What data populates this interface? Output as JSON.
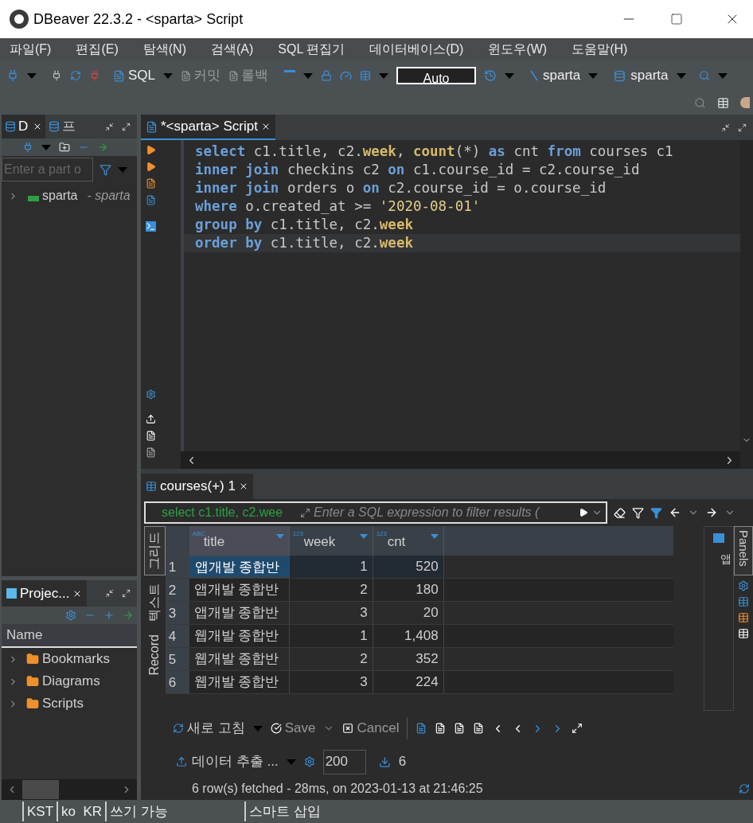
{
  "window": {
    "title": "DBeaver 22.3.2 - <sparta> Script"
  },
  "menu": [
    "파일(F)",
    "편집(E)",
    "탐색(N)",
    "검색(A)",
    "SQL 편집기",
    "데이터베이스(D)",
    "윈도우(W)",
    "도움말(H)"
  ],
  "toolbar": {
    "sql": "SQL",
    "commit": "커밋",
    "rollback": "롤백",
    "transaction_mode": "Auto",
    "datasource": "sparta",
    "schema": "sparta"
  },
  "navigator": {
    "tabs": [
      {
        "label": "D",
        "selected": true
      },
      {
        "label": "프",
        "selected": false
      }
    ],
    "filter": {
      "placeholder": "Enter a part o"
    },
    "tree": [
      {
        "label": "sparta",
        "detail": "- sparta",
        "expanded": false
      }
    ]
  },
  "projects": {
    "tab": "Projec...",
    "column": "Name",
    "items": [
      {
        "label": "Bookmarks",
        "expanded": false
      },
      {
        "label": "Diagrams",
        "expanded": false
      },
      {
        "label": "Scripts",
        "expanded": false
      }
    ]
  },
  "editor": {
    "tab": "*<sparta> Script",
    "lines": [
      {
        "current": false,
        "tokens": [
          {
            "kind": "keyword",
            "text": "select"
          },
          {
            "kind": "plain",
            "text": " c1.title, c2."
          },
          {
            "kind": "field",
            "text": "week"
          },
          {
            "kind": "plain",
            "text": ", "
          },
          {
            "kind": "field",
            "text": "count"
          },
          {
            "kind": "plain",
            "text": "(*) "
          },
          {
            "kind": "keyword",
            "text": "as"
          },
          {
            "kind": "plain",
            "text": " cnt "
          },
          {
            "kind": "keyword",
            "text": "from"
          },
          {
            "kind": "plain",
            "text": " courses c1"
          }
        ]
      },
      {
        "current": false,
        "tokens": [
          {
            "kind": "keyword",
            "text": "inner join"
          },
          {
            "kind": "plain",
            "text": " checkins c2 "
          },
          {
            "kind": "keyword",
            "text": "on"
          },
          {
            "kind": "plain",
            "text": " c1.course_id = c2.course_id"
          }
        ]
      },
      {
        "current": false,
        "tokens": [
          {
            "kind": "keyword",
            "text": "inner join"
          },
          {
            "kind": "plain",
            "text": " orders o "
          },
          {
            "kind": "keyword",
            "text": "on"
          },
          {
            "kind": "plain",
            "text": " c2.course_id = o.course_id"
          }
        ]
      },
      {
        "current": false,
        "tokens": [
          {
            "kind": "keyword",
            "text": "where"
          },
          {
            "kind": "plain",
            "text": " o.created_at >= "
          },
          {
            "kind": "string",
            "text": "'2020-08-01'"
          }
        ]
      },
      {
        "current": false,
        "tokens": [
          {
            "kind": "keyword",
            "text": "group by"
          },
          {
            "kind": "plain",
            "text": " c1.title, c2."
          },
          {
            "kind": "field",
            "text": "week"
          }
        ]
      },
      {
        "current": true,
        "tokens": [
          {
            "kind": "keyword",
            "text": "order by"
          },
          {
            "kind": "plain",
            "text": " c1.title, c2."
          },
          {
            "kind": "field",
            "text": "week"
          }
        ]
      }
    ]
  },
  "results": {
    "tab": "courses(+) 1",
    "query": "select c1.title, c2.wee",
    "filter": {
      "placeholder": "Enter a SQL expression to filter results ("
    },
    "side_tabs": [
      {
        "label": "그리드",
        "selected": true
      },
      {
        "label": "텍스트",
        "selected": false
      },
      {
        "label": "Record",
        "selected": false
      }
    ],
    "columns": [
      {
        "name": "title",
        "type": "ABC",
        "kind": "text"
      },
      {
        "name": "week",
        "type": "123",
        "kind": "number"
      },
      {
        "name": "cnt",
        "type": "123",
        "kind": "number"
      }
    ],
    "rows": [
      {
        "number": "1",
        "cells": [
          "앱개발 종합반",
          "1",
          "520"
        ],
        "selected": true
      },
      {
        "number": "2",
        "cells": [
          "앱개발 종합반",
          "2",
          "180"
        ],
        "selected": false
      },
      {
        "number": "3",
        "cells": [
          "앱개발 종합반",
          "3",
          "20"
        ],
        "selected": false
      },
      {
        "number": "4",
        "cells": [
          "웹개발 종합반",
          "1",
          "1,408"
        ],
        "selected": false
      },
      {
        "number": "5",
        "cells": [
          "웹개발 종합반",
          "2",
          "352"
        ],
        "selected": false
      },
      {
        "number": "6",
        "cells": [
          "웹개발 종합반",
          "3",
          "224"
        ],
        "selected": false
      }
    ],
    "side_panel": {
      "label": "앱",
      "tab": "Panels"
    },
    "refresh": "새로 고침",
    "save": "Save",
    "cancel": "Cancel",
    "export": "데이터 추출 ...",
    "fetch_size": "200",
    "row_count": "6",
    "status": "6 row(s) fetched - 28ms, on 2023-01-13 at 21:46:25"
  },
  "status_bar": [
    "KST",
    "ko  KR",
    "쓰기 가능",
    "스마트 삽입"
  ]
}
